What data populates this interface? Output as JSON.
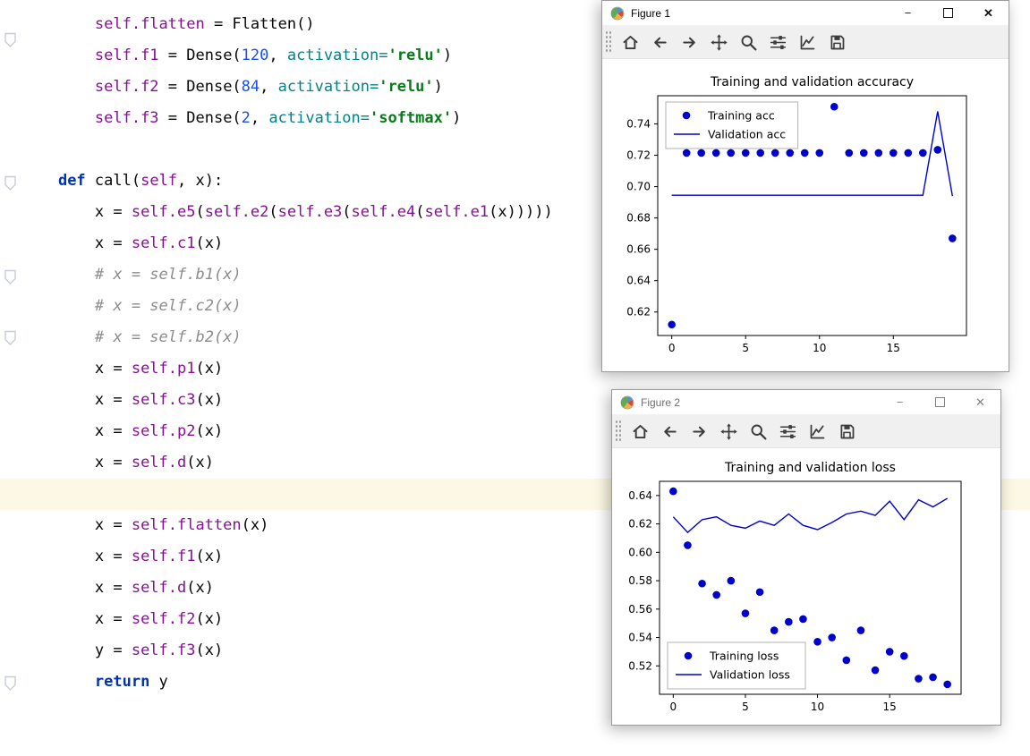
{
  "editor": {
    "current_line": 15,
    "lines": [
      {
        "tokens": [
          [
            "        ",
            "pl"
          ],
          [
            "self.flatten",
            "at"
          ],
          [
            " = Flatten()",
            "pl"
          ]
        ]
      },
      {
        "tokens": [
          [
            "        ",
            "pl"
          ],
          [
            "self.f1",
            "at"
          ],
          [
            " = Dense(",
            "pl"
          ],
          [
            "120",
            "nm"
          ],
          [
            ", ",
            "pl"
          ],
          [
            "activation=",
            "pr"
          ],
          [
            "'relu'",
            "st"
          ],
          [
            ")",
            "pl"
          ]
        ]
      },
      {
        "tokens": [
          [
            "        ",
            "pl"
          ],
          [
            "self.f2",
            "at"
          ],
          [
            " = Dense(",
            "pl"
          ],
          [
            "84",
            "nm"
          ],
          [
            ", ",
            "pl"
          ],
          [
            "activation=",
            "pr"
          ],
          [
            "'relu'",
            "st"
          ],
          [
            ")",
            "pl"
          ]
        ]
      },
      {
        "tokens": [
          [
            "        ",
            "pl"
          ],
          [
            "self.f3",
            "at"
          ],
          [
            " = Dense(",
            "pl"
          ],
          [
            "2",
            "nm"
          ],
          [
            ", ",
            "pl"
          ],
          [
            "activation=",
            "pr"
          ],
          [
            "'softmax'",
            "st"
          ],
          [
            ")",
            "pl"
          ]
        ]
      },
      {
        "tokens": []
      },
      {
        "tokens": [
          [
            "    ",
            "pl"
          ],
          [
            "def ",
            "kw"
          ],
          [
            "call(",
            "pl"
          ],
          [
            "self",
            "at"
          ],
          [
            ", x):",
            "pl"
          ]
        ]
      },
      {
        "tokens": [
          [
            "        x = ",
            "pl"
          ],
          [
            "self.e5",
            "at"
          ],
          [
            "(",
            "pl"
          ],
          [
            "self.e2",
            "at"
          ],
          [
            "(",
            "pl"
          ],
          [
            "self.e3",
            "at"
          ],
          [
            "(",
            "pl"
          ],
          [
            "self.e4",
            "at"
          ],
          [
            "(",
            "pl"
          ],
          [
            "self.e1",
            "at"
          ],
          [
            "(x)))))",
            "pl"
          ]
        ]
      },
      {
        "tokens": [
          [
            "        x = ",
            "pl"
          ],
          [
            "self.c1",
            "at"
          ],
          [
            "(x)",
            "pl"
          ]
        ]
      },
      {
        "tokens": [
          [
            "        ",
            "pl"
          ],
          [
            "# x = self.b1(x)",
            "cm"
          ]
        ]
      },
      {
        "tokens": [
          [
            "        ",
            "pl"
          ],
          [
            "# x = self.c2(x)",
            "cm"
          ]
        ]
      },
      {
        "tokens": [
          [
            "        ",
            "pl"
          ],
          [
            "# x = self.b2(x)",
            "cm"
          ]
        ]
      },
      {
        "tokens": [
          [
            "        x = ",
            "pl"
          ],
          [
            "self.p1",
            "at"
          ],
          [
            "(x)",
            "pl"
          ]
        ]
      },
      {
        "tokens": [
          [
            "        x = ",
            "pl"
          ],
          [
            "self.c3",
            "at"
          ],
          [
            "(x)",
            "pl"
          ]
        ]
      },
      {
        "tokens": [
          [
            "        x = ",
            "pl"
          ],
          [
            "self.p2",
            "at"
          ],
          [
            "(x)",
            "pl"
          ]
        ]
      },
      {
        "tokens": [
          [
            "        x = ",
            "pl"
          ],
          [
            "self.d",
            "at"
          ],
          [
            "(x)",
            "pl"
          ]
        ]
      },
      {
        "tokens": []
      },
      {
        "tokens": [
          [
            "        x = ",
            "pl"
          ],
          [
            "self.flatten",
            "at"
          ],
          [
            "(x)",
            "pl"
          ]
        ]
      },
      {
        "tokens": [
          [
            "        x = ",
            "pl"
          ],
          [
            "self.f1",
            "at"
          ],
          [
            "(x)",
            "pl"
          ]
        ]
      },
      {
        "tokens": [
          [
            "        x = ",
            "pl"
          ],
          [
            "self.d",
            "at"
          ],
          [
            "(x)",
            "pl"
          ]
        ]
      },
      {
        "tokens": [
          [
            "        x = ",
            "pl"
          ],
          [
            "self.f2",
            "at"
          ],
          [
            "(x)",
            "pl"
          ]
        ]
      },
      {
        "tokens": [
          [
            "        y = ",
            "pl"
          ],
          [
            "self.f3",
            "at"
          ],
          [
            "(x)",
            "pl"
          ]
        ]
      },
      {
        "tokens": [
          [
            "        ",
            "pl"
          ],
          [
            "return ",
            "kw"
          ],
          [
            "y",
            "pl"
          ]
        ]
      }
    ]
  },
  "windows": [
    {
      "title": "Figure 1",
      "controls": {
        "minimize": "−",
        "close": "✕"
      },
      "toolbar_icons": [
        "home",
        "back",
        "forward",
        "pan",
        "zoom",
        "subplots",
        "customize",
        "save"
      ]
    },
    {
      "title": "Figure 2",
      "controls": {
        "minimize": "−",
        "close": "✕"
      },
      "toolbar_icons": [
        "home",
        "back",
        "forward",
        "pan",
        "zoom",
        "subplots",
        "customize",
        "save"
      ]
    }
  ],
  "chart_data": [
    {
      "type": "scatter",
      "title": "Training and validation accuracy",
      "x": [
        0,
        1,
        2,
        3,
        4,
        5,
        6,
        7,
        8,
        9,
        10,
        11,
        12,
        13,
        14,
        15,
        16,
        17,
        18,
        19
      ],
      "series": [
        {
          "name": "Training acc",
          "style": "scatter",
          "values": [
            0.612,
            0.7215,
            0.7215,
            0.7215,
            0.7215,
            0.7215,
            0.7215,
            0.7215,
            0.7215,
            0.7215,
            0.7215,
            0.751,
            0.7215,
            0.7215,
            0.7215,
            0.7215,
            0.7215,
            0.7215,
            0.7235,
            0.667
          ]
        },
        {
          "name": "Validation acc",
          "style": "line",
          "values": [
            0.6945,
            0.6945,
            0.6945,
            0.6945,
            0.6945,
            0.6945,
            0.6945,
            0.6945,
            0.6945,
            0.6945,
            0.6945,
            0.6945,
            0.6945,
            0.6945,
            0.6945,
            0.6945,
            0.6945,
            0.6945,
            0.748,
            0.694
          ]
        }
      ],
      "xticks": [
        0,
        5,
        10,
        15
      ],
      "yticks": [
        0.62,
        0.64,
        0.66,
        0.68,
        0.7,
        0.72,
        0.74
      ],
      "xlim": [
        -0.95,
        19.95
      ],
      "ylim": [
        0.605,
        0.758
      ],
      "legend_position": "upper-left",
      "color": "#0000cc"
    },
    {
      "type": "scatter",
      "title": "Training and validation loss",
      "x": [
        0,
        1,
        2,
        3,
        4,
        5,
        6,
        7,
        8,
        9,
        10,
        11,
        12,
        13,
        14,
        15,
        16,
        17,
        18,
        19
      ],
      "series": [
        {
          "name": "Training loss",
          "style": "scatter",
          "values": [
            0.643,
            0.605,
            0.578,
            0.57,
            0.58,
            0.557,
            0.572,
            0.545,
            0.551,
            0.553,
            0.537,
            0.54,
            0.524,
            0.545,
            0.517,
            0.53,
            0.527,
            0.511,
            0.512,
            0.507
          ]
        },
        {
          "name": "Validation loss",
          "style": "line",
          "values": [
            0.625,
            0.614,
            0.623,
            0.625,
            0.619,
            0.617,
            0.622,
            0.619,
            0.627,
            0.619,
            0.616,
            0.621,
            0.627,
            0.629,
            0.626,
            0.636,
            0.623,
            0.637,
            0.632,
            0.638
          ]
        }
      ],
      "xticks": [
        0,
        5,
        10,
        15
      ],
      "yticks": [
        0.52,
        0.54,
        0.56,
        0.58,
        0.6,
        0.62,
        0.64
      ],
      "xlim": [
        -0.95,
        19.95
      ],
      "ylim": [
        0.5,
        0.65
      ],
      "legend_position": "lower-left",
      "color": "#0000cc"
    }
  ]
}
